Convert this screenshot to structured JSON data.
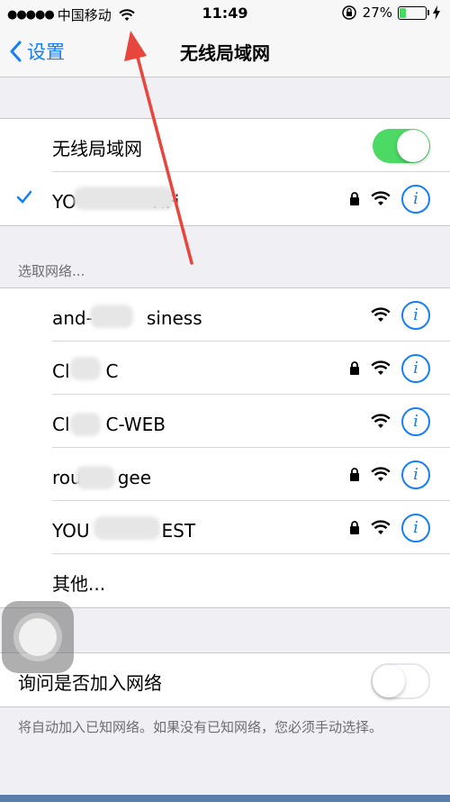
{
  "status": {
    "signal_dots": "●●●●●",
    "carrier": "中国移动",
    "time": "11:49",
    "battery": "27%",
    "battery_level": 0.27
  },
  "nav": {
    "back_label": "设置",
    "title": "无线局域网"
  },
  "wlan": {
    "label": "无线局域网",
    "enabled": true,
    "connected": "YO　　　　ViFi"
  },
  "section_choose": "选取网络...",
  "networks": [
    {
      "name": "and-　　　siness",
      "locked": false
    },
    {
      "name": "Cl　　C",
      "locked": true
    },
    {
      "name": "Cl　　C-WEB",
      "locked": false
    },
    {
      "name": "rou　　gee",
      "locked": true
    },
    {
      "name": "YOU　　　　EST",
      "locked": true
    }
  ],
  "other_label": "其他...",
  "ask_join": {
    "label": "询问是否加入网络",
    "enabled": false
  },
  "footer_note": "将自动加入已知网络。如果没有已知网络，您必须手动选择。",
  "colors": {
    "accent": "#147efb",
    "toggle_on": "#4cd964",
    "arrow": "#e8453c"
  },
  "icons": [
    "signal-dots-icon",
    "wifi-icon",
    "orientation-lock-icon",
    "battery-icon",
    "charging-icon",
    "chevron-left-icon",
    "checkmark-icon",
    "lock-icon",
    "info-icon",
    "assistive-touch-icon"
  ]
}
